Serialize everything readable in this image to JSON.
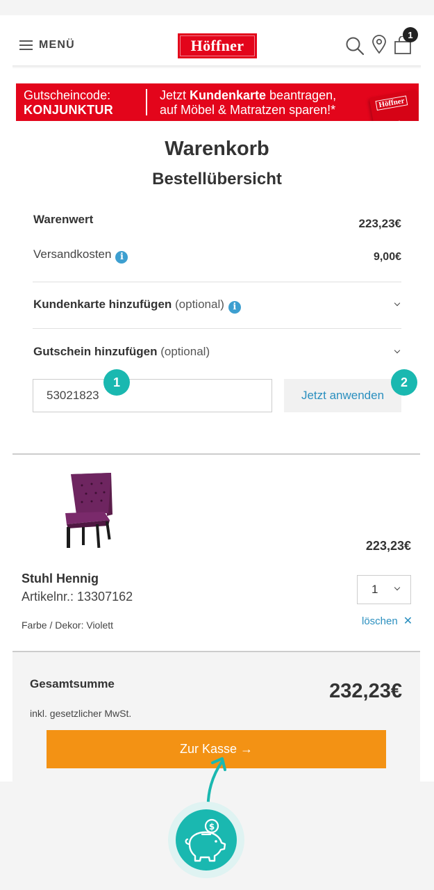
{
  "header": {
    "menu_label": "MENÜ",
    "logo_text": "Höffner",
    "cart_count": "1",
    "icons": [
      "menu-icon",
      "search-icon",
      "location-pin-icon",
      "shopping-bag-icon"
    ]
  },
  "banner": {
    "code_label": "Gutscheincode:",
    "code": "KONJUNKTUR",
    "promo_line1_pre": "Jetzt ",
    "promo_line1_bold": "Kundenkarte",
    "promo_line1_post": " beantragen,",
    "promo_line2": "auf Möbel & Matratzen sparen!*",
    "card_logo": "Höffner"
  },
  "cart": {
    "title": "Warenkorb",
    "subtitle": "Bestellübersicht",
    "goods_label": "Warenwert",
    "goods_value": "223,23€",
    "shipping_label": "Versandkosten",
    "shipping_value": "9,00€",
    "customer_card_label": "Kundenkarte hinzufügen",
    "customer_card_optional": "(optional)",
    "voucher_label": "Gutschein hinzufügen",
    "voucher_optional": "(optional)",
    "voucher_value": "53021823",
    "apply_label": "Jetzt anwenden",
    "step1": "1",
    "step2": "2"
  },
  "product": {
    "price": "223,23€",
    "name": "Stuhl Hennig",
    "article": "Artikelnr.: 13307162",
    "color": "Farbe / Dekor: Violett",
    "quantity": "1",
    "delete_label": "löschen"
  },
  "summary": {
    "total_label": "Gesamtsumme",
    "total_value": "232,23€",
    "vat_note": "inkl. gesetzlicher MwSt.",
    "checkout_label": "Zur Kasse →"
  },
  "colors": {
    "brand_red": "#e3051b",
    "accent_teal": "#1ab8b0",
    "link_blue": "#2a8fbf",
    "checkout_orange": "#f39214"
  }
}
